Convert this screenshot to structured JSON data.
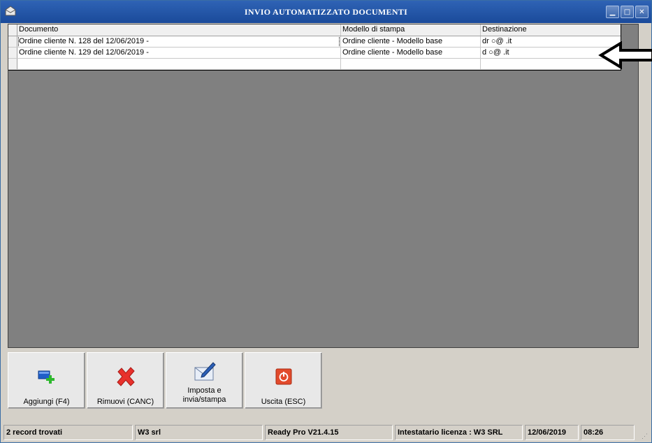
{
  "window": {
    "title": "INVIO AUTOMATIZZATO DOCUMENTI",
    "controls": [
      "minimize-icon",
      "maximize-icon",
      "close-icon"
    ]
  },
  "grid": {
    "columns": [
      "Documento",
      "Modello di stampa",
      "Destinazione"
    ],
    "rows": [
      {
        "documento": "Ordine cliente N. 128 del 12/06/2019 -",
        "modello": "Ordine cliente - Modello base",
        "destinazione": "dr            ○@        .it",
        "selected": true
      },
      {
        "documento": "Ordine cliente N. 129 del 12/06/2019 -",
        "modello": "Ordine cliente - Modello base",
        "destinazione": "d             ○@      .it",
        "selected": false
      },
      {
        "documento": "",
        "modello": "",
        "destinazione": "",
        "selected": false
      }
    ]
  },
  "toolbar": {
    "add_label": "Aggiungi (F4)",
    "remove_label": "Rimuovi (CANC)",
    "send_label_line1": "Imposta e",
    "send_label_line2": "invia/stampa",
    "exit_label": "Uscita (ESC)"
  },
  "statusbar": {
    "records": "2 record trovati",
    "company": "W3 srl",
    "version": "Ready Pro V21.4.15",
    "license": "Intestatario licenza : W3 SRL",
    "date": "12/06/2019",
    "time": "08:26"
  },
  "colors": {
    "titlebar": "#2f63b5",
    "grid_background": "#808080",
    "window_background": "#d4d0c8"
  }
}
